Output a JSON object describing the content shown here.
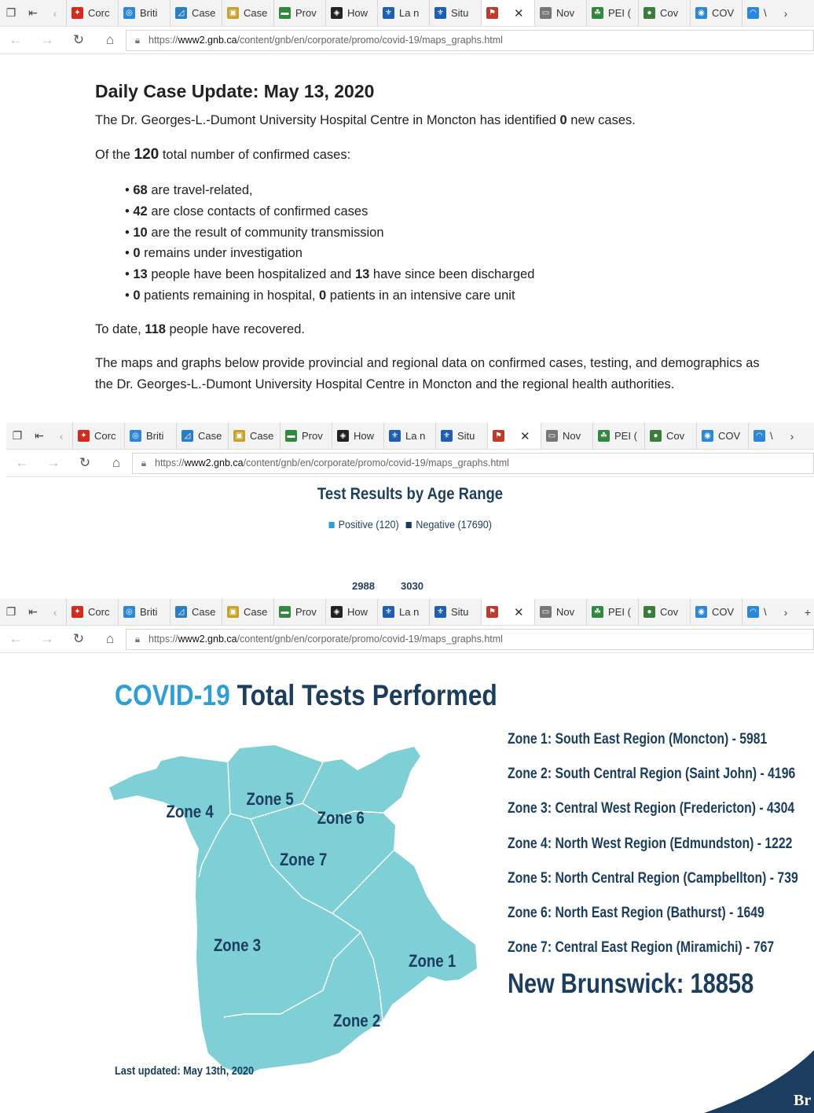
{
  "tabs": [
    {
      "label": "Corc",
      "color": "#d52b1e",
      "glyph": "✦"
    },
    {
      "label": "Briti",
      "color": "#2b88d8",
      "glyph": "◎"
    },
    {
      "label": "Case",
      "color": "#2a7fc1",
      "glyph": "◿"
    },
    {
      "label": "Case",
      "color": "#c9a227",
      "glyph": "▣"
    },
    {
      "label": "Prov",
      "color": "#2f8a3d",
      "glyph": "▬"
    },
    {
      "label": "How",
      "color": "#222222",
      "glyph": "◈"
    },
    {
      "label": "La n",
      "color": "#1f5fb0",
      "glyph": "⚜"
    },
    {
      "label": "Situ",
      "color": "#1f5fb0",
      "glyph": "⚜"
    },
    {
      "label": "",
      "color": "#c0392b",
      "glyph": "⚑",
      "active": true
    },
    {
      "label": "Nov",
      "color": "#777777",
      "glyph": "▭"
    },
    {
      "label": "PEI (",
      "color": "#2f8a3d",
      "glyph": "☘"
    },
    {
      "label": "Cov",
      "color": "#3b7d3b",
      "glyph": "●"
    },
    {
      "label": "COV",
      "color": "#2b88d8",
      "glyph": "◉"
    },
    {
      "label": "\\",
      "color": "#2b88d8",
      "glyph": "◠"
    }
  ],
  "browser": {
    "url_prefix": "https://",
    "url_host": "www2.gnb.ca",
    "url_path": "/content/gnb/en/corporate/promo/covid-19/maps_graphs.html"
  },
  "update": {
    "heading": "Daily Case Update: May 13, 2020",
    "intro_a": "The Dr. Georges-L.-Dumont University Hospital Centre in Moncton has identified ",
    "intro_n": "0",
    "intro_b": " new cases.",
    "total_a": "Of the ",
    "total_n": "120",
    "total_b": " total number of confirmed cases:",
    "items": [
      {
        "n": "68",
        "t": " are travel-related,"
      },
      {
        "n": "42",
        "t": " are close contacts of confirmed cases"
      },
      {
        "n": "10",
        "t": " are the result of community transmission"
      },
      {
        "n": "0",
        "t": " remains under investigation"
      },
      {
        "n": "13",
        "t": " people have been hospitalized and ",
        "n2": "13",
        "t2": " have since been discharged"
      },
      {
        "n": "0",
        "t": " patients remaining in hospital, ",
        "n2": "0",
        "t2": " patients in an intensive care unit"
      }
    ],
    "recovered_a": "To date, ",
    "recovered_n": "118",
    "recovered_b": " people have recovered.",
    "maps_line1": "The maps and graphs below provide provincial and regional data on confirmed cases, testing, and demographics as",
    "maps_line2": "the Dr. Georges-L.-Dumont University Hospital Centre in Moncton and the regional health authorities."
  },
  "age_chart": {
    "title": "Test Results by Age Range",
    "positive_label": "Positive (120)",
    "negative_label": "Negative (17690)",
    "positive_color": "#2a9fd8",
    "negative_color": "#1b3e60",
    "visible_values": [
      "2988",
      "3030"
    ]
  },
  "tests": {
    "title_a": "COVID-19",
    "title_b": " Total Tests Performed",
    "zones": [
      "Zone 1: South East Region (Moncton) - 5981",
      "Zone 2: South Central Region (Saint John) - 4196",
      "Zone 3: Central West Region (Fredericton) - 4304",
      "Zone 4: North West Region (Edmundston) - 1222",
      "Zone 5: North Central Region (Campbellton) - 739",
      "Zone 6: North East Region (Bathurst) - 1649",
      "Zone 7: Central East Region (Miramichi) - 767"
    ],
    "total": "New Brunswick: 18858",
    "updated": "Last updated: May 13th, 2020",
    "map_labels": [
      "Zone 1",
      "Zone 2",
      "Zone 3",
      "Zone 4",
      "Zone 5",
      "Zone 6",
      "Zone 7"
    ],
    "map_color": "#7fd0d6",
    "corner_text": "Br"
  }
}
